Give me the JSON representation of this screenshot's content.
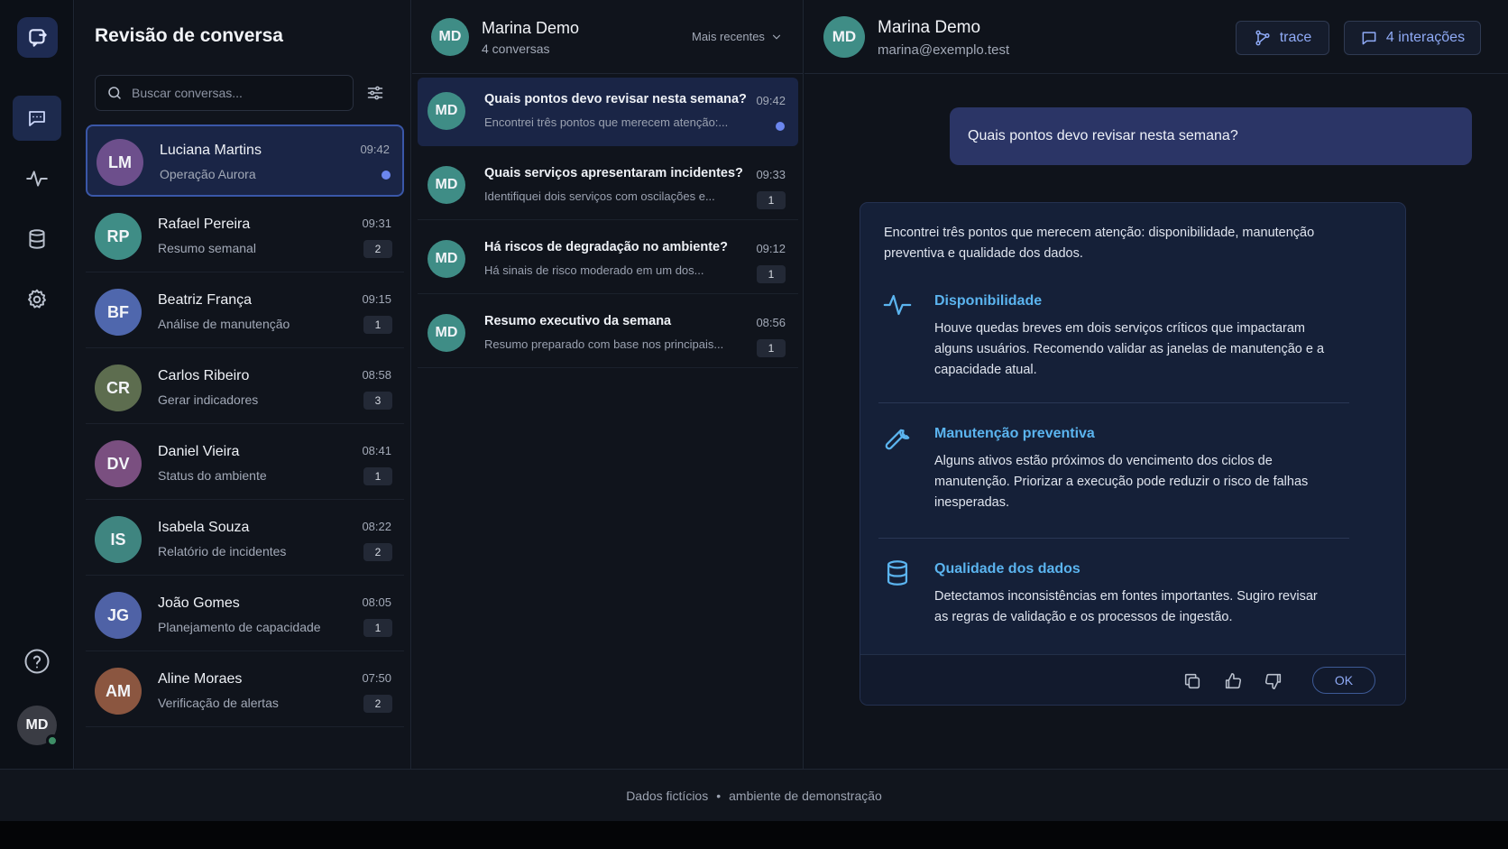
{
  "colors": {
    "accent": "#6b86ee",
    "section_title": "#5bb4ef",
    "active_bg": "#1a2546"
  },
  "rail": {
    "logo_icon": "chat-window-logo-icon",
    "nav": [
      {
        "name": "conversations",
        "icon": "message-square-icon",
        "active": true
      },
      {
        "name": "activity",
        "icon": "pulse-icon",
        "active": false
      },
      {
        "name": "database",
        "icon": "database-icon",
        "active": false
      },
      {
        "name": "settings",
        "icon": "gear-icon",
        "active": false
      }
    ],
    "help_icon": "help-circle-icon",
    "user_initials": "MD"
  },
  "list": {
    "title": "Revisão de conversa",
    "search_placeholder": "Buscar conversas...",
    "contacts": [
      {
        "initials": "LM",
        "name": "Luciana Martins",
        "subtitle": "Operação Aurora",
        "time": "09:42",
        "badge": "",
        "unread": true,
        "active": true,
        "color": "#6d4f8c"
      },
      {
        "initials": "RP",
        "name": "Rafael Pereira",
        "subtitle": "Resumo semanal",
        "time": "09:31",
        "badge": "2",
        "unread": false,
        "active": false,
        "color": "#3f8d86"
      },
      {
        "initials": "BF",
        "name": "Beatriz França",
        "subtitle": "Análise de manutenção",
        "time": "09:15",
        "badge": "1",
        "unread": false,
        "active": false,
        "color": "#4f67ad"
      },
      {
        "initials": "CR",
        "name": "Carlos Ribeiro",
        "subtitle": "Gerar indicadores",
        "time": "08:58",
        "badge": "3",
        "unread": false,
        "active": false,
        "color": "#5d6d4f"
      },
      {
        "initials": "DV",
        "name": "Daniel Vieira",
        "subtitle": "Status do ambiente",
        "time": "08:41",
        "badge": "1",
        "unread": false,
        "active": false,
        "color": "#7a4f80"
      },
      {
        "initials": "IS",
        "name": "Isabela Souza",
        "subtitle": "Relatório de incidentes",
        "time": "08:22",
        "badge": "2",
        "unread": false,
        "active": false,
        "color": "#3f8580"
      },
      {
        "initials": "JG",
        "name": "João Gomes",
        "subtitle": "Planejamento de capacidade",
        "time": "08:05",
        "badge": "1",
        "unread": false,
        "active": false,
        "color": "#4f62a6"
      },
      {
        "initials": "AM",
        "name": "Aline Moraes",
        "subtitle": "Verificação de alertas",
        "time": "07:50",
        "badge": "2",
        "unread": false,
        "active": false,
        "color": "#8b5640"
      }
    ]
  },
  "conversations": {
    "contact_initials": "MD",
    "contact_name": "Marina Demo",
    "count": "4 conversas",
    "sort_label": "Mais recentes",
    "items": [
      {
        "initials": "MD",
        "question": "Quais pontos devo revisar nesta semana?",
        "preview": "Encontrei três pontos que merecem atenção:...",
        "time": "09:42",
        "badge": "",
        "unread": true,
        "active": true
      },
      {
        "initials": "MD",
        "question": "Quais serviços apresentaram incidentes?",
        "preview": "Identifiquei dois serviços com oscilações e...",
        "time": "09:33",
        "badge": "1",
        "unread": false,
        "active": false
      },
      {
        "initials": "MD",
        "question": "Há riscos de degradação no ambiente?",
        "preview": "Há sinais de risco moderado em um dos...",
        "time": "09:12",
        "badge": "1",
        "unread": false,
        "active": false
      },
      {
        "initials": "MD",
        "question": "Resumo executivo da semana",
        "preview": "Resumo preparado com base nos principais...",
        "time": "08:56",
        "badge": "1",
        "unread": false,
        "active": false
      }
    ]
  },
  "detail": {
    "initials": "MD",
    "name": "Marina Demo",
    "email": "marina@exemplo.test",
    "trace_label": "trace",
    "interactions_label": "4 interações",
    "user_message": "Quais pontos devo revisar nesta semana?",
    "answer_intro": "Encontrei três pontos que merecem atenção: disponibilidade, manutenção preventiva e qualidade dos dados.",
    "sections": [
      {
        "icon": "pulse-icon",
        "title": "Disponibilidade",
        "text": "Houve quedas breves em dois serviços críticos que impactaram alguns usuários. Recomendo validar as janelas de manutenção e a capacidade atual."
      },
      {
        "icon": "wrench-icon",
        "title": "Manutenção preventiva",
        "text": "Alguns ativos estão próximos do vencimento dos ciclos de manutenção. Priorizar a execução pode reduzir o risco de falhas inesperadas."
      },
      {
        "icon": "database-icon",
        "title": "Qualidade dos dados",
        "text": "Detectamos inconsistências em fontes importantes. Sugiro revisar as regras de validação e os processos de ingestão."
      }
    ],
    "ok_label": "OK"
  },
  "footer": {
    "left": "Dados fictícios",
    "separator": "•",
    "right": "ambiente de demonstração"
  }
}
